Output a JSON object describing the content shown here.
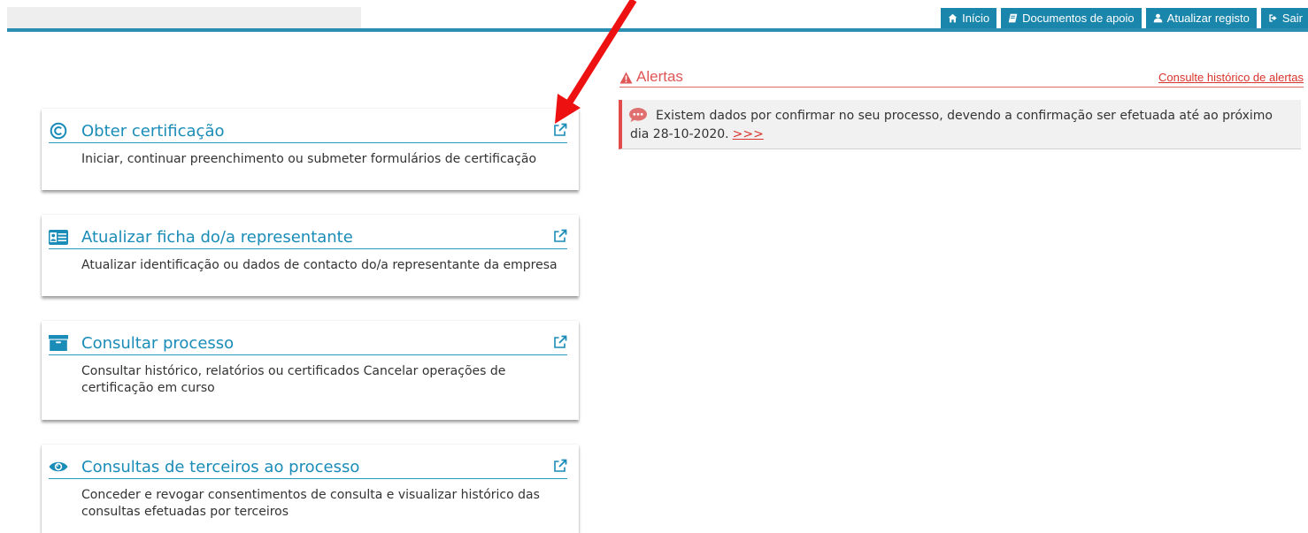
{
  "topnav": {
    "items": [
      {
        "label": "Início",
        "icon": "home-icon"
      },
      {
        "label": "Documentos de apoio",
        "icon": "book-icon"
      },
      {
        "label": "Atualizar registo",
        "icon": "user-icon"
      },
      {
        "label": "Sair",
        "icon": "sign-out-icon"
      }
    ]
  },
  "cards": [
    {
      "title": "Obter certificação",
      "icon": "copyright-icon",
      "description": "Iniciar, continuar preenchimento ou submeter formulários de certificação"
    },
    {
      "title": "Atualizar ficha do/a representante",
      "icon": "id-card-icon",
      "description": "Atualizar identificação ou dados de contacto do/a representante da empresa"
    },
    {
      "title": "Consultar processo",
      "icon": "archive-icon",
      "description": "Consultar histórico, relatórios ou certificados Cancelar operações de certificação em curso"
    },
    {
      "title": "Consultas de terceiros ao processo",
      "icon": "eye-icon",
      "description": "Conceder e revogar consentimentos de consulta e visualizar histórico das consultas efetuadas por terceiros"
    }
  ],
  "alerts": {
    "title": "Alertas",
    "history_link": "Consulte histórico de alertas",
    "items": [
      {
        "text": "Existem dados por confirmar no seu processo, devendo a confirmação ser efetuada até ao próximo dia 28-10-2020.",
        "link": ">>>"
      }
    ]
  },
  "colors": {
    "primary": "#1b86ab",
    "link": "#1a8cb8",
    "alert": "#e05555",
    "annotation_arrow": "#ee1111"
  }
}
